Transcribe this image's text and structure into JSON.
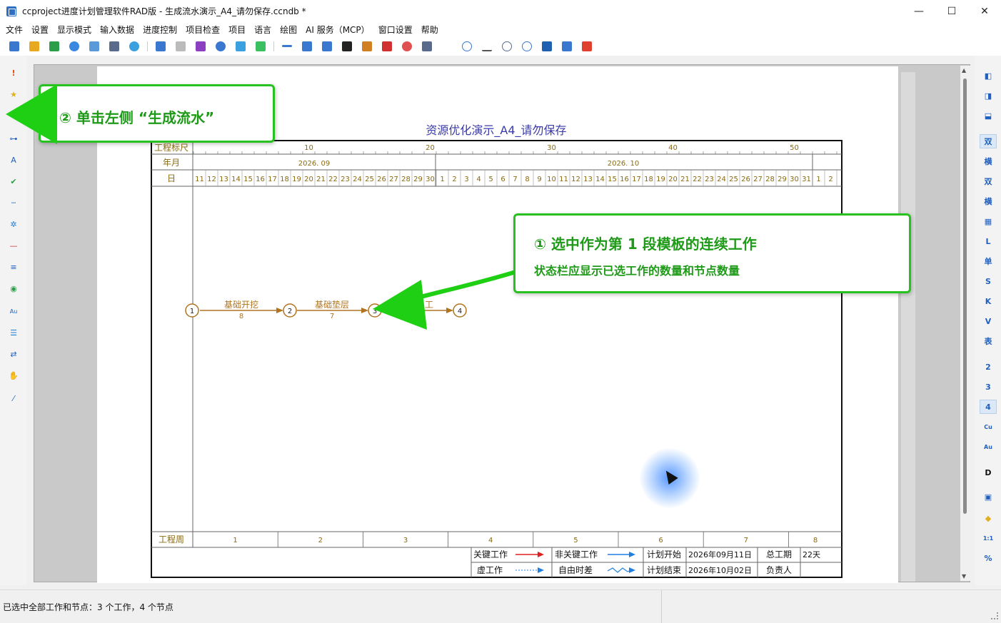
{
  "window": {
    "title": "ccproject进度计划管理软件RAD版 - 生成流水演示_A4_请勿保存.ccndb *",
    "minimize": "—",
    "maximize": "☐",
    "close": "✕"
  },
  "menu": [
    "文件",
    "设置",
    "显示模式",
    "输入数据",
    "进度控制",
    "项目检查",
    "项目",
    "语言",
    "绘图",
    "AI 服务（MCP）",
    "窗口设置",
    "帮助"
  ],
  "right_bar_labels": [
    "双",
    "横",
    "双",
    "横",
    "L",
    "单",
    "S",
    "K",
    "V",
    "表",
    "2",
    "3",
    "4",
    "Cu",
    "Au",
    "D",
    "1:1",
    "%"
  ],
  "chart": {
    "title": "资源优化演示_A4_请勿保存",
    "ruler_label": "工程标尺",
    "month_label": "年月",
    "day_label": "日",
    "week_label": "工程周",
    "ruler_ticks": [
      "10",
      "20",
      "30",
      "40",
      "50"
    ],
    "months": [
      "2026. 09",
      "2026. 10"
    ],
    "days": [
      "11",
      "12",
      "13",
      "14",
      "15",
      "16",
      "17",
      "18",
      "19",
      "20",
      "21",
      "22",
      "23",
      "24",
      "25",
      "26",
      "27",
      "28",
      "29",
      "30",
      "1",
      "2",
      "3",
      "4",
      "5",
      "6",
      "7",
      "8",
      "9",
      "10",
      "11",
      "12",
      "13",
      "14",
      "15",
      "16",
      "17",
      "18",
      "19",
      "20",
      "21",
      "22",
      "23",
      "24",
      "25",
      "26",
      "27",
      "28",
      "29",
      "30",
      "31",
      "1",
      "2"
    ],
    "weeks": [
      "1",
      "2",
      "3",
      "4",
      "5",
      "6",
      "7",
      "8"
    ],
    "nodes": [
      "1",
      "2",
      "3",
      "4"
    ],
    "activities": [
      {
        "name": "基础开挖",
        "duration": "8"
      },
      {
        "name": "基础垫层",
        "duration": "7"
      },
      {
        "name": "",
        "duration": ""
      }
    ],
    "partial_label": "工",
    "legend": {
      "critical": "关键工作",
      "noncritical": "非关键工作",
      "dummy": "虚工作",
      "free_float": "自由时差",
      "plan_start_label": "计划开始",
      "plan_start": "2026年09月11日",
      "plan_end_label": "计划结束",
      "plan_end": "2026年10月02日",
      "total_label": "总工期",
      "total": "22天",
      "owner_label": "负责人",
      "owner": ""
    }
  },
  "callouts": {
    "left": "② 单击左侧 “生成流水”",
    "right_title": "① 选中作为第 1 段模板的连续工作",
    "right_sub": "状态栏应显示已选工作的数量和节点数量"
  },
  "status": "已选中全部工作和节点：3 个工作，4 个节点",
  "colors": {
    "accent_green": "#27c21f",
    "critical": "#e02020",
    "noncritical": "#1e7fe0",
    "activity": "#b07420"
  }
}
